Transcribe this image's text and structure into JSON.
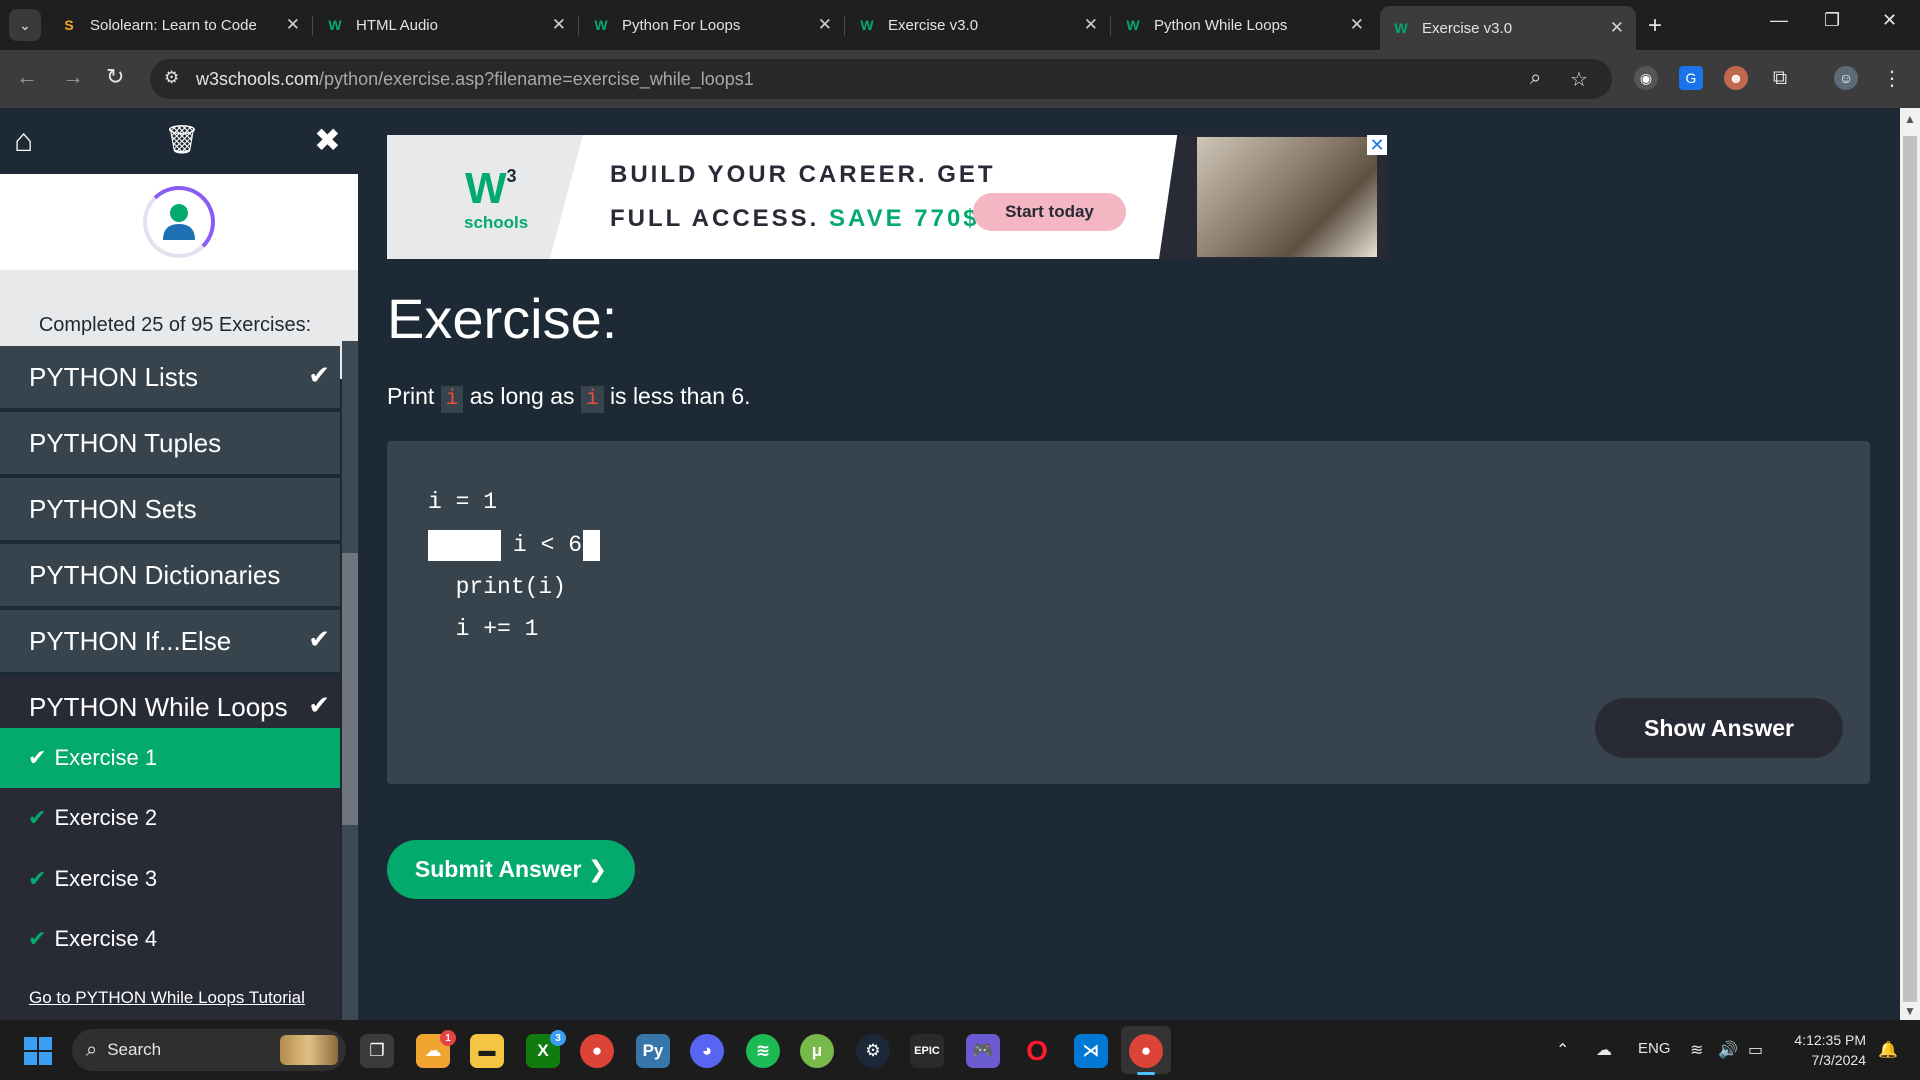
{
  "browser": {
    "tabs": [
      {
        "title": "Sololearn: Learn to Code",
        "favicon": "sololearn-icon"
      },
      {
        "title": "HTML Audio",
        "favicon": "w3schools-icon"
      },
      {
        "title": "Python For Loops",
        "favicon": "w3schools-icon"
      },
      {
        "title": "Exercise v3.0",
        "favicon": "w3schools-icon"
      },
      {
        "title": "Python While Loops",
        "favicon": "w3schools-icon"
      },
      {
        "title": "Exercise v3.0",
        "favicon": "w3schools-icon",
        "active": true
      }
    ],
    "url_host": "w3schools.com",
    "url_path": "/python/exercise.asp?filename=exercise_while_loops1"
  },
  "sidebar": {
    "completed_text": "Completed 25 of 95 Exercises:",
    "categories": [
      {
        "label": "PYTHON Lists",
        "done": true
      },
      {
        "label": "PYTHON Tuples",
        "done": false
      },
      {
        "label": "PYTHON Sets",
        "done": false
      },
      {
        "label": "PYTHON Dictionaries",
        "done": false
      },
      {
        "label": "PYTHON If...Else",
        "done": true
      },
      {
        "label": "PYTHON While Loops",
        "done": true
      }
    ],
    "exercises": [
      {
        "label": "Exercise 1",
        "active": true
      },
      {
        "label": "Exercise 2",
        "active": false
      },
      {
        "label": "Exercise 3",
        "active": false
      },
      {
        "label": "Exercise 4",
        "active": false
      }
    ],
    "tutorial_link": "Go to PYTHON While Loops Tutorial"
  },
  "ad": {
    "brand": "W3",
    "brand_sub": "schools",
    "line1": "BUILD YOUR CAREER. GET",
    "line2_a": "FULL ACCESS.",
    "line2_b": "SAVE 770$",
    "button": "Start today",
    "close": "✕"
  },
  "exercise": {
    "title": "Exercise:",
    "prompt_a": "Print",
    "prompt_var1": "i",
    "prompt_b": "as long as",
    "prompt_var2": "i",
    "prompt_c": "is less than 6.",
    "code": {
      "line1": "i = 1",
      "line2_rest": "i < 6",
      "line3": "  print(i)",
      "line4": "  i += 1"
    },
    "show_answer": "Show Answer",
    "submit": "Submit Answer ❯"
  },
  "taskbar": {
    "search_placeholder": "Search",
    "language": "ENG",
    "time": "4:12:35 PM",
    "date": "7/3/2024",
    "badges": {
      "weather": "1",
      "xbox": "3"
    }
  },
  "colors": {
    "w3_green": "#04aa6d",
    "page_bg": "#1d2a35",
    "code_bg": "#38444d",
    "sidebar_item_bg": "#38444d",
    "dark_button": "#282a35"
  }
}
